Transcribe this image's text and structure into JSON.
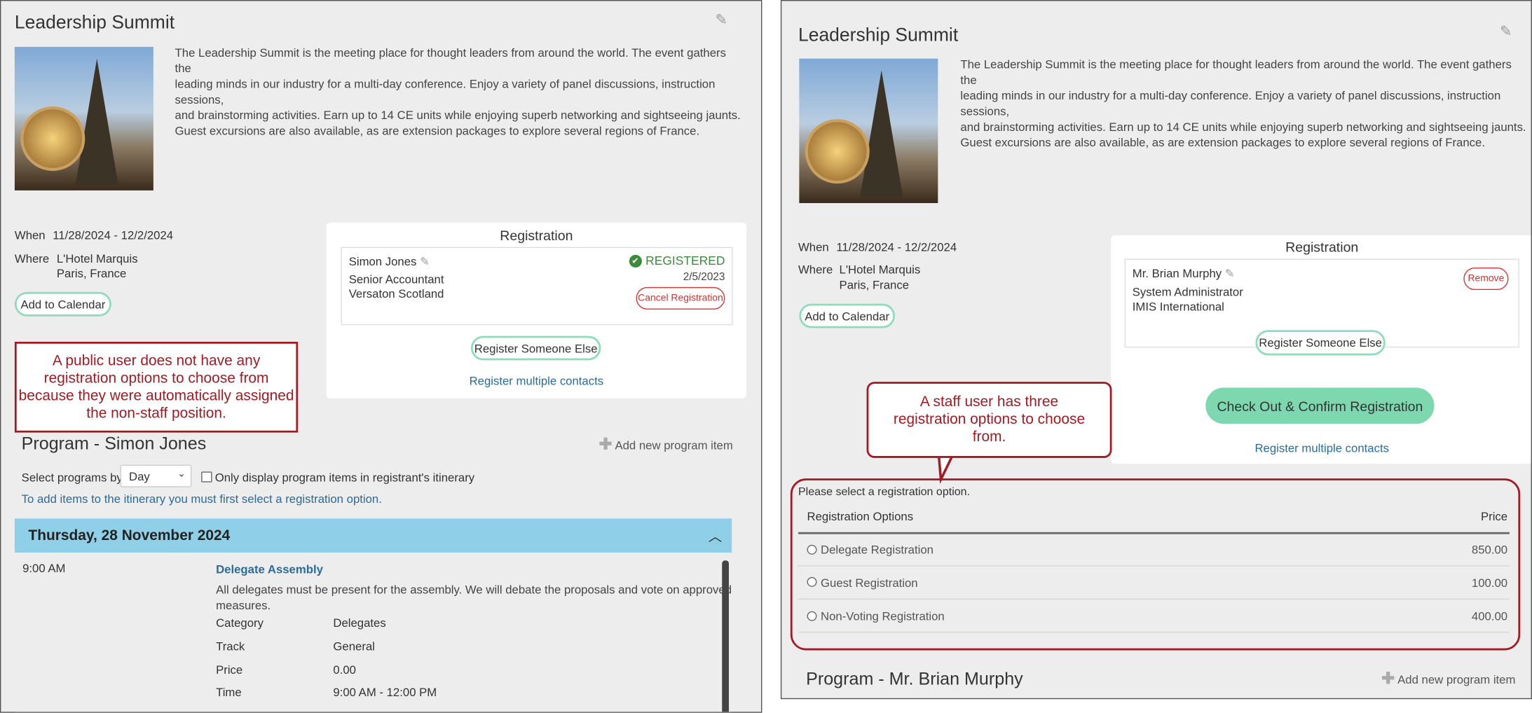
{
  "left": {
    "title": "Leadership Summit",
    "description_lines": [
      "The Leadership Summit is the meeting place for thought leaders from around the world. The event gathers the",
      "leading minds in our industry for a multi-day conference. Enjoy a variety of panel discussions, instruction sessions,",
      "and brainstorming activities. Earn up to 14 CE units while enjoying superb networking and sightseeing jaunts.",
      "Guest excursions are also available, as are extension packages to explore several regions of France."
    ],
    "when_label": "When",
    "when_value": "11/28/2024 - 12/2/2024",
    "where_label": "Where",
    "where_line1": "L'Hotel Marquis",
    "where_line2": "Paris, France",
    "add_to_calendar": "Add to Calendar",
    "registration": {
      "title": "Registration",
      "name": "Simon Jones",
      "job_title": "Senior Accountant",
      "organization": "Versaton Scotland",
      "status": "REGISTERED",
      "date": "2/5/2023",
      "cancel_label": "Cancel Registration",
      "register_someone_else": "Register Someone Else",
      "register_multiple": "Register multiple contacts"
    },
    "callout": "A public user does not have any registration options to choose from because they were automatically assigned the non-staff position.",
    "program_title": "Program - Simon Jones",
    "add_program_item": "Add new program item",
    "select_by_label": "Select programs by",
    "select_by_value": "Day",
    "only_display_label": "Only display program items in registrant's itinerary",
    "itinerary_notice": "To add items to the itinerary you must first select a registration option.",
    "day_header": "Thursday, 28 November 2024",
    "item": {
      "time": "9:00 AM",
      "title": "Delegate Assembly",
      "description_line1": "All delegates must be present for the assembly. We will debate the proposals and vote on approved",
      "description_line2": "measures.",
      "fields": [
        {
          "label": "Category",
          "value": "Delegates"
        },
        {
          "label": "Track",
          "value": "General"
        },
        {
          "label": "Price",
          "value": "0.00"
        },
        {
          "label": "Time",
          "value": "9:00 AM - 12:00 PM"
        }
      ]
    }
  },
  "right": {
    "title": "Leadership Summit",
    "description_lines": [
      "The Leadership Summit is the meeting place for thought leaders from around the world. The event gathers the",
      "leading minds in our industry for a multi-day conference. Enjoy a variety of panel discussions, instruction sessions,",
      "and brainstorming activities. Earn up to 14 CE units while enjoying superb networking and sightseeing jaunts.",
      "Guest excursions are also available, as are extension packages to explore several regions of France."
    ],
    "when_label": "When",
    "when_value": "11/28/2024 - 12/2/2024",
    "where_label": "Where",
    "where_line1": "L'Hotel Marquis",
    "where_line2": "Paris, France",
    "add_to_calendar": "Add to Calendar",
    "registration": {
      "title": "Registration",
      "name": "Mr. Brian Murphy",
      "job_title": "System Administrator",
      "organization": "IMIS International",
      "remove_label": "Remove",
      "register_someone_else": "Register Someone Else",
      "checkout_label": "Check Out & Confirm Registration",
      "register_multiple": "Register multiple contacts"
    },
    "callout": "A staff user has three registration options to choose from.",
    "select_prompt": "Please select a registration option.",
    "options_header": "Registration Options",
    "price_header": "Price",
    "options": [
      {
        "label": "Delegate Registration",
        "price": "850.00"
      },
      {
        "label": "Guest Registration",
        "price": "100.00"
      },
      {
        "label": "Non-Voting Registration",
        "price": "400.00"
      }
    ],
    "program_title": "Program - Mr. Brian Murphy",
    "add_program_item": "Add new program item"
  },
  "colors": {
    "accent_green": "#7dd8b0",
    "callout_red": "#a31a22",
    "link_blue": "#2a6b9a",
    "day_header_blue": "#8fd0e8",
    "registered_green": "#3c8a3c"
  }
}
